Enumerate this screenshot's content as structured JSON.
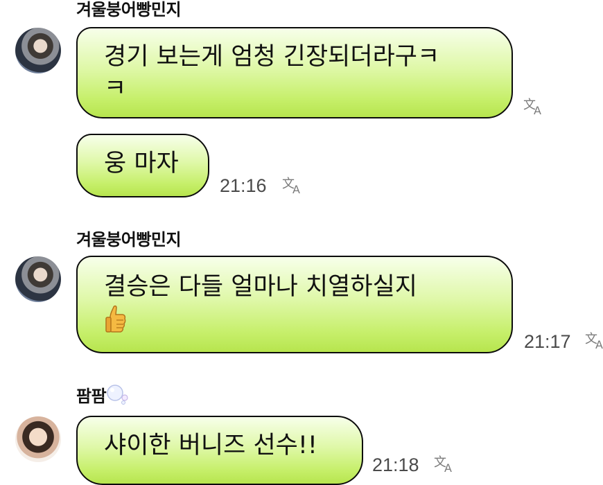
{
  "messages": [
    {
      "sender": "겨울붕어빵민지",
      "bubbles": [
        {
          "text": "경기 보는게 엄청 긴장되더라구ㅋ\nㅋ",
          "time": ""
        },
        {
          "text": "웅 마자",
          "time": "21:16"
        }
      ]
    },
    {
      "sender": "겨울붕어빵민지",
      "bubbles": [
        {
          "text": "결승은 다들 얼마나 치열하실지",
          "time": "21:17",
          "emoji": "thumbs-up"
        }
      ]
    },
    {
      "sender": "팜팜",
      "sender_emoji": "bubbles",
      "bubbles": [
        {
          "text": "샤이한 버니즈 선수!!",
          "time": "21:18"
        }
      ]
    }
  ],
  "icons": {
    "translate": "translate-icon",
    "avatar": "avatar"
  },
  "colors": {
    "bubble_top": "#f7ffea",
    "bubble_bottom": "#b7e54e",
    "border": "#0b0b0b"
  }
}
